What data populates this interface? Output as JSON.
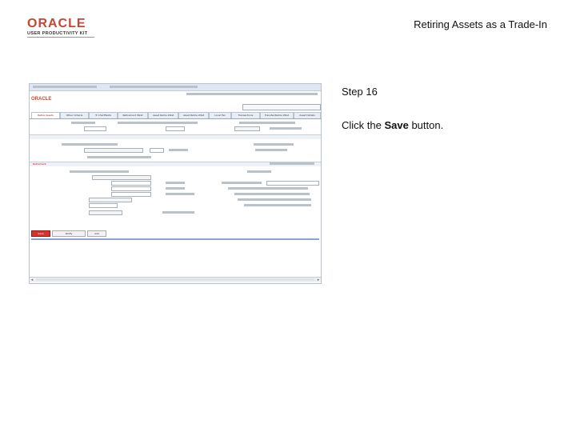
{
  "header": {
    "logo_word": "ORACLE",
    "logo_sub": "USER PRODUCTIVITY KIT",
    "title": "Retiring Assets as a Trade-In"
  },
  "step": "Step 16",
  "instruction": {
    "before": "Click the ",
    "bold": "Save",
    "after": " button."
  },
  "screenshot": {
    "logo": "ORACLE",
    "tabs": [
      "Retire Assets",
      "Other Criteria",
      "Tr Chartfields",
      "Retirement Wkst",
      "Asset Retire Wkst",
      "Asset Retire Wkst",
      "Local Tax",
      "Transactions",
      "Transfer/Retire Wkst",
      "Asset Details"
    ],
    "section_label": "Retirement",
    "save_label": "Save",
    "button_labels": [
      "Notify",
      "Add"
    ],
    "colors": {
      "brand": "#c74634",
      "save_button": "#d9342b"
    }
  }
}
